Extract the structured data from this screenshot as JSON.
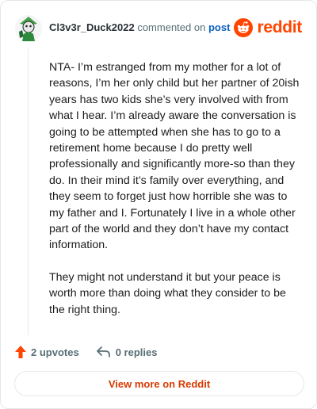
{
  "header": {
    "username": "Cl3v3r_Duck2022",
    "action_text": "commented on",
    "post_link": "post",
    "brand": "reddit"
  },
  "comment": {
    "paragraphs": [
      "NTA- I’m estranged from my mother for a lot of reasons, I’m her only child but her partner of 20ish years has two kids she’s very involved with from what I hear. I’m already aware the conversation is going to be attempted when she has to go to a retirement home because I do pretty well professionally and significantly more-so than they do. In their mind it’s family over everything, and they seem to forget just how horrible she was to my father and I. Fortunately I live in a whole other part of the world and they don’t have my contact information.",
      "They might not understand it but your peace is worth more than doing what they consider to be the right thing."
    ]
  },
  "actions": {
    "upvotes": "2 upvotes",
    "replies": "0 replies"
  },
  "footer": {
    "view_more": "View more on Reddit"
  },
  "colors": {
    "brand": "#ff4500",
    "link": "#0b61c1",
    "muted": "#576f76",
    "cta": "#d93a00"
  },
  "icons": [
    "avatar",
    "reddit-logo-icon",
    "upvote-arrow-icon",
    "reply-icon"
  ]
}
